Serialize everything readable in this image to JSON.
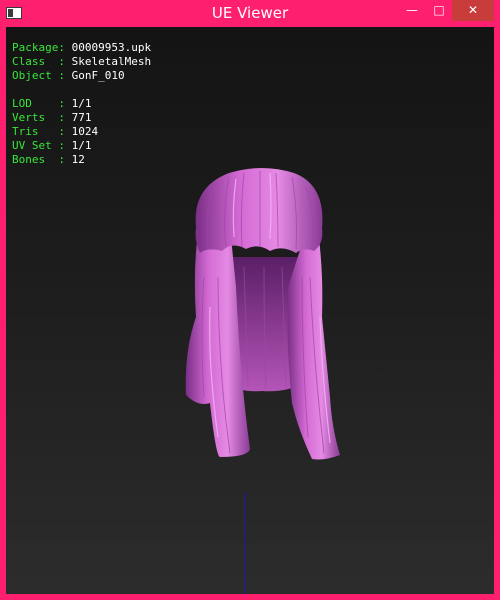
{
  "window": {
    "title": "UE Viewer",
    "buttons": {
      "minimize": "—",
      "maximize": "□",
      "close": "✕"
    },
    "frame_color": "#ff1f6f"
  },
  "mesh_info": {
    "package_label": "Package:",
    "package": "00009953.upk",
    "class_label": "Class  :",
    "class": "SkeletalMesh",
    "object_label": "Object :",
    "object": "GonF_010",
    "lod_label": "LOD    :",
    "lod": "1/1",
    "verts_label": "Verts  :",
    "verts": "771",
    "tris_label": "Tris   :",
    "tris": "1024",
    "uvset_label": "UV Set :",
    "uvset": "1/1",
    "bones_label": "Bones  :",
    "bones": "12"
  },
  "colors": {
    "label_green": "#39e639",
    "hair_pink": "#d46ad4",
    "axis_blue": "#1a1ab0"
  },
  "icons": [
    "app-icon",
    "minimize-icon",
    "maximize-icon",
    "close-icon"
  ]
}
